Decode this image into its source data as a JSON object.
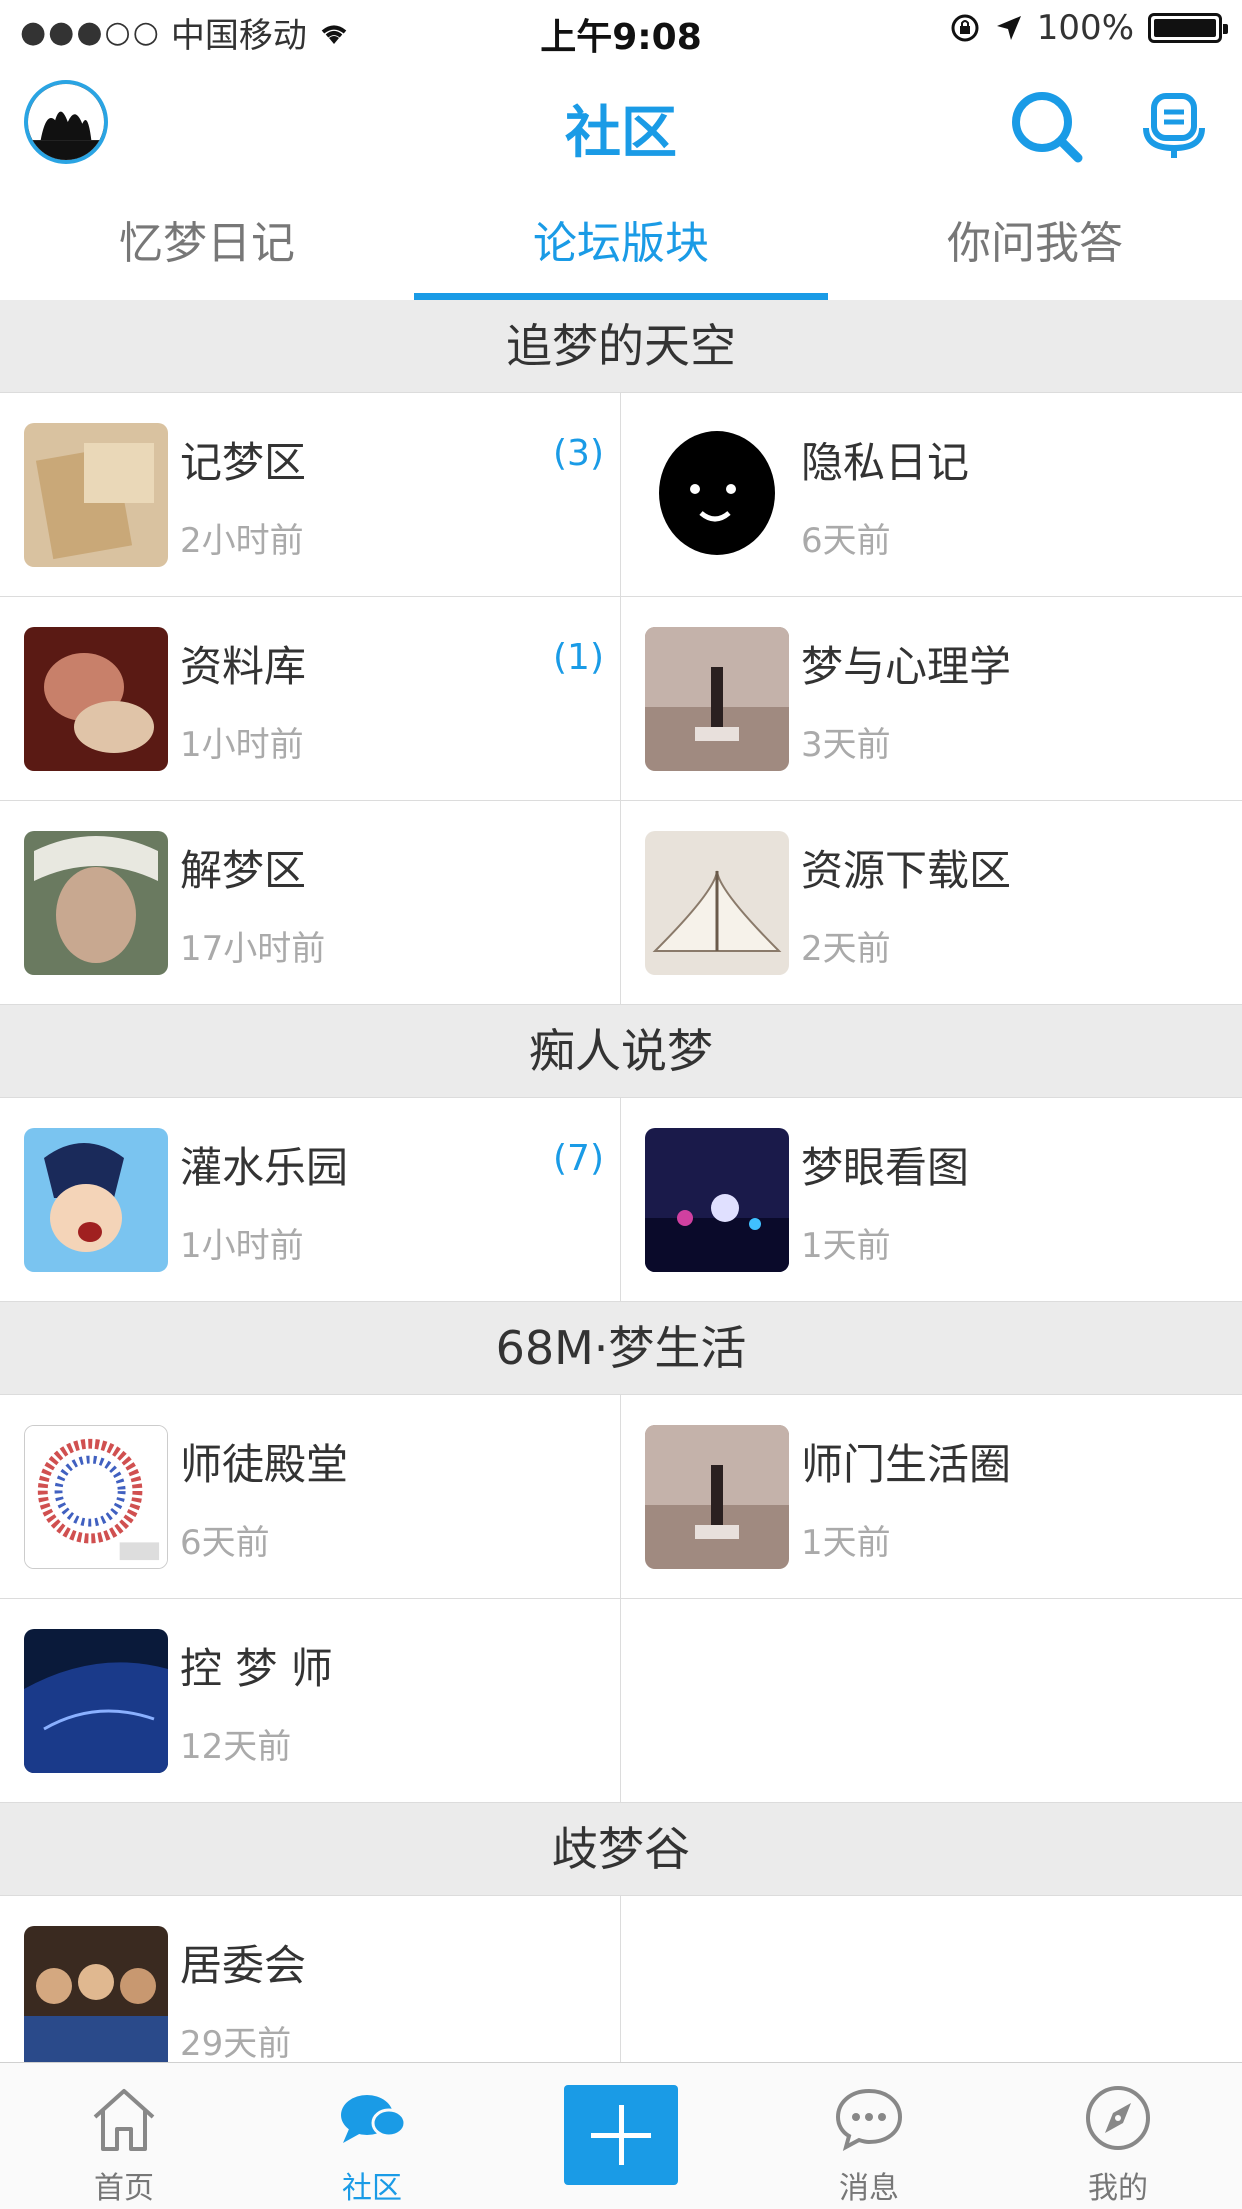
{
  "status_bar": {
    "signal": "●●●○○",
    "carrier": "中国移动",
    "time": "上午9:08",
    "battery": "100%"
  },
  "header": {
    "title": "社区"
  },
  "tabs": [
    {
      "label": "忆梦日记",
      "active": false
    },
    {
      "label": "论坛版块",
      "active": true
    },
    {
      "label": "你问我答",
      "active": false
    }
  ],
  "sections": [
    {
      "title": "追梦的天空",
      "items": [
        {
          "name": "记梦区",
          "time": "2小时前",
          "count": "(3)"
        },
        {
          "name": "隐私日记",
          "time": "6天前",
          "count": ""
        },
        {
          "name": "资料库",
          "time": "1小时前",
          "count": "(1)"
        },
        {
          "name": "梦与心理学",
          "time": "3天前",
          "count": ""
        },
        {
          "name": "解梦区",
          "time": "17小时前",
          "count": ""
        },
        {
          "name": "资源下载区",
          "time": "2天前",
          "count": ""
        }
      ]
    },
    {
      "title": "痴人说梦",
      "items": [
        {
          "name": "灌水乐园",
          "time": "1小时前",
          "count": "(7)"
        },
        {
          "name": "梦眼看图",
          "time": "1天前",
          "count": ""
        }
      ]
    },
    {
      "title": "68M·梦生活",
      "items": [
        {
          "name": "师徒殿堂",
          "time": "6天前",
          "count": ""
        },
        {
          "name": "师门生活圈",
          "time": "1天前",
          "count": ""
        },
        {
          "name": "控 梦 师",
          "time": "12天前",
          "count": ""
        }
      ]
    },
    {
      "title": "歧梦谷",
      "items": [
        {
          "name": "居委会",
          "time": "29天前",
          "count": ""
        }
      ]
    }
  ],
  "tabbar": {
    "home": "首页",
    "community": "社区",
    "messages": "消息",
    "mine": "我的"
  },
  "colors": {
    "accent": "#1a9be6"
  }
}
